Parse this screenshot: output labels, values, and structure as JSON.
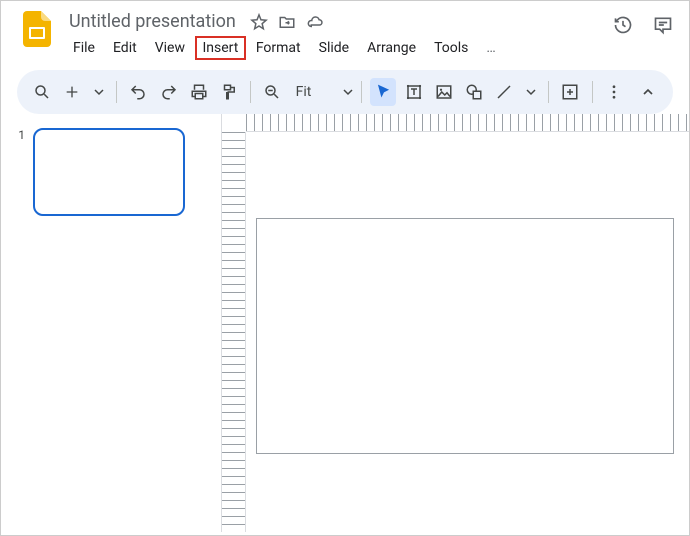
{
  "header": {
    "title": "Untitled presentation"
  },
  "menu": {
    "file": "File",
    "edit": "Edit",
    "view": "View",
    "insert": "Insert",
    "format": "Format",
    "slide": "Slide",
    "arrange": "Arrange",
    "tools": "Tools",
    "more": "…"
  },
  "toolbar": {
    "zoom_label": "Fit"
  },
  "sidebar": {
    "slides": [
      {
        "num": "1"
      }
    ]
  },
  "highlighted_menu": "insert"
}
